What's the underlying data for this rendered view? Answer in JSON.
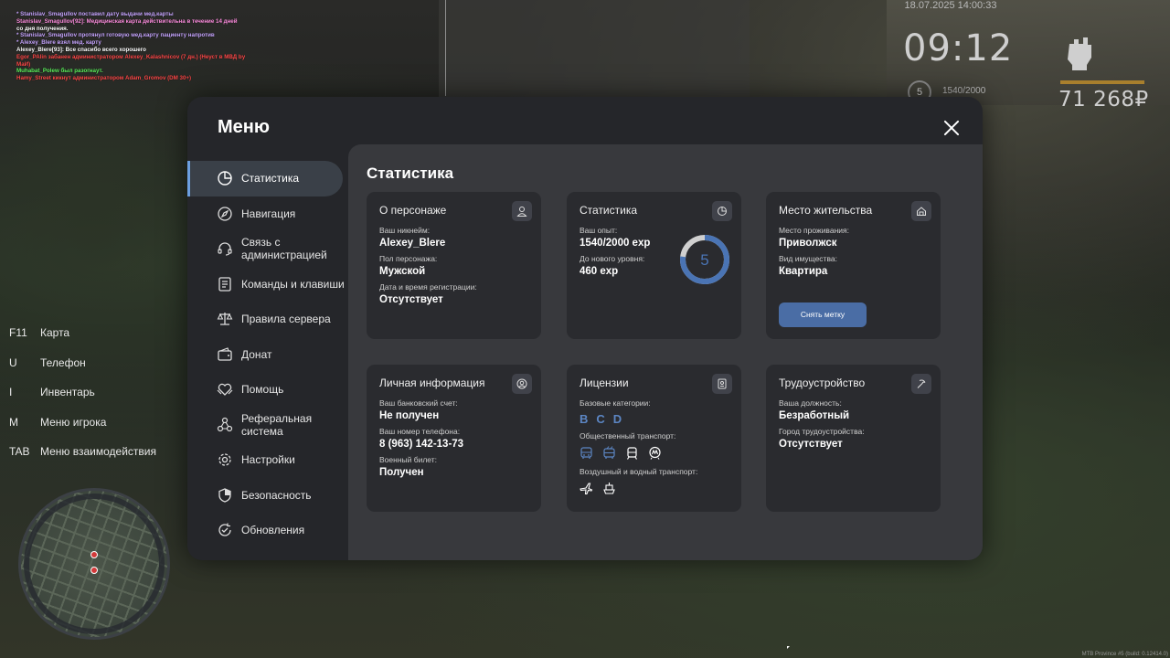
{
  "chat": [
    {
      "text": "* Stanislav_Smagullov поставил дату выдачи мед.карты",
      "color": "#c7a6ff"
    },
    {
      "text": "Stanislav_Smagullov[92]: Медицинская карта действительна в течение 14 дней",
      "color": "#ff8fe0"
    },
    {
      "text": "со дня получения.",
      "color": "#ffffff"
    },
    {
      "text": "* Stanislav_Smagullov протянул готовую мед.карту пациенту напротив",
      "color": "#c7a6ff"
    },
    {
      "text": "* Alexey_Blere взял мед. карту",
      "color": "#c7a6ff"
    },
    {
      "text": "Alexey_Blere[93]: Все спасибо всего хорошего",
      "color": "#ffffff"
    },
    {
      "text": "Egor_PAlin забанен администратором Alexey_Kalashnicov (7 дн.) (Неуст в МВД by МаЯ)",
      "color": "#ff4a4a"
    },
    {
      "text": "МаЙ)",
      "color": "#ff4a4a"
    },
    {
      "text": "Muhabat_Polew был разогнаут.",
      "color": "#5ef05e"
    },
    {
      "text": "Hamy_Street кикнут администратором Adam_Gromov (DM 30+)",
      "color": "#ff4a4a"
    }
  ],
  "hud": {
    "date": "18.07.2025 14:00:33",
    "time": "09:12",
    "level": "5",
    "exp": "1540/2000",
    "money": "71 268₽"
  },
  "keys": [
    {
      "key": "F11",
      "label": "Карта"
    },
    {
      "key": "U",
      "label": "Телефон"
    },
    {
      "key": "I",
      "label": "Инвентарь"
    },
    {
      "key": "M",
      "label": "Меню игрока"
    },
    {
      "key": "TAB",
      "label": "Меню взаимодействия"
    }
  ],
  "footer": "МТВ Province #5 (build: 0.12414.0)",
  "menu": {
    "title": "Меню",
    "sidebar": [
      {
        "label": "Статистика",
        "icon": "chart-pie-icon"
      },
      {
        "label": "Навигация",
        "icon": "compass-icon"
      },
      {
        "label": "Связь с администрацией",
        "icon": "headset-icon"
      },
      {
        "label": "Команды и клавиши",
        "icon": "document-icon"
      },
      {
        "label": "Правила сервера",
        "icon": "scales-icon"
      },
      {
        "label": "Донат",
        "icon": "wallet-icon"
      },
      {
        "label": "Помощь",
        "icon": "heart-hands-icon"
      },
      {
        "label": "Реферальная система",
        "icon": "network-icon"
      },
      {
        "label": "Настройки",
        "icon": "gear-icon"
      },
      {
        "label": "Безопасность",
        "icon": "shield-icon"
      },
      {
        "label": "Обновления",
        "icon": "update-icon"
      }
    ],
    "content_title": "Статистика",
    "cards": {
      "character": {
        "title": "О персонаже",
        "nick_label": "Ваш никнейм:",
        "nick": "Alexey_Blere",
        "gender_label": "Пол персонажа:",
        "gender": "Мужской",
        "reg_label": "Дата и время регистрации:",
        "reg": "Отсутствует"
      },
      "stats": {
        "title": "Статистика",
        "exp_label": "Ваш опыт:",
        "exp": "1540/2000 exp",
        "next_label": "До нового уровня:",
        "next": "460 exp",
        "level": "5",
        "progress": 0.77
      },
      "residence": {
        "title": "Место жительства",
        "place_label": "Место проживания:",
        "place": "Приволжск",
        "prop_label": "Вид имущества:",
        "prop": "Квартира",
        "button": "Снять метку"
      },
      "personal": {
        "title": "Личная информация",
        "bank_label": "Ваш банковский счет:",
        "bank": "Не получен",
        "phone_label": "Ваш номер телефона:",
        "phone": "8 (963) 142-13-73",
        "military_label": "Военный билет:",
        "military": "Получен"
      },
      "licenses": {
        "title": "Лицензии",
        "base_label": "Базовые категории:",
        "categories": [
          "B",
          "C",
          "D"
        ],
        "public_label": "Общественный транспорт:",
        "air_label": "Воздушный и водный транспорт:"
      },
      "job": {
        "title": "Трудоустройство",
        "position_label": "Ваша должность:",
        "position": "Безработный",
        "city_label": "Город трудоустройства:",
        "city": "Отсутствует"
      }
    }
  }
}
